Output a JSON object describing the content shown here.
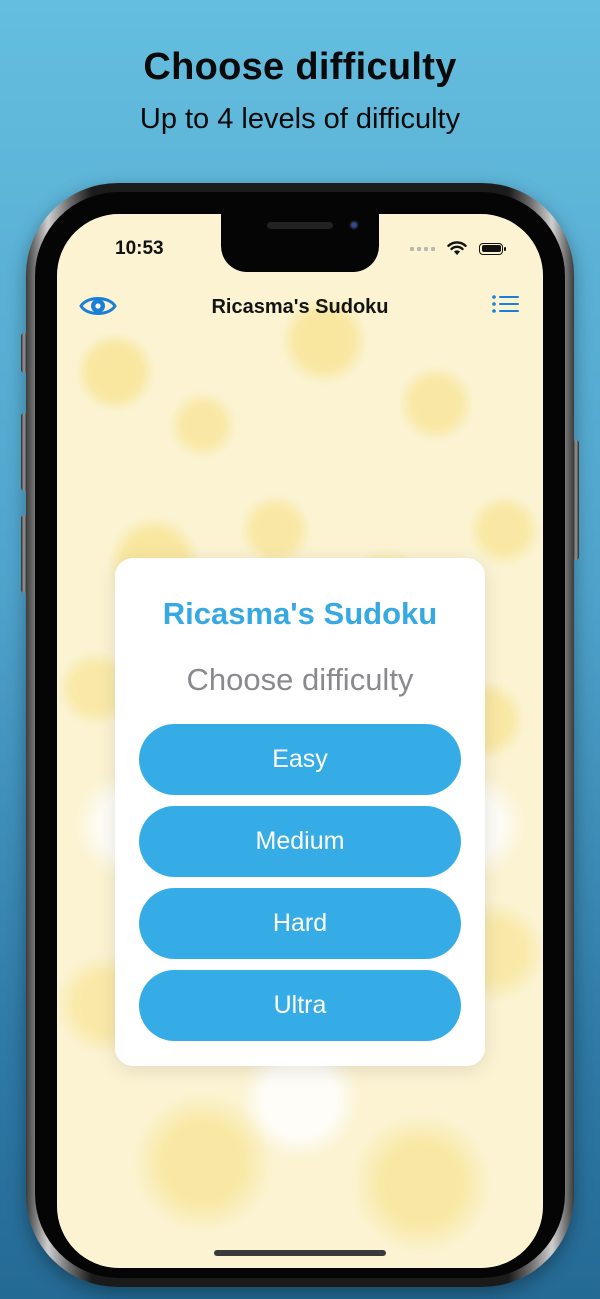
{
  "promo": {
    "title": "Choose difficulty",
    "subtitle": "Up to 4 levels of difficulty"
  },
  "status_bar": {
    "time": "10:53",
    "icons": [
      "cellular-signal-icon",
      "wifi-icon",
      "battery-icon"
    ]
  },
  "nav_bar": {
    "title": "Ricasma's Sudoku",
    "left_icon": "eye-icon",
    "right_icon": "list-icon",
    "accent_color": "#1a7fd8"
  },
  "dialog": {
    "title": "Ricasma's Sudoku",
    "subtitle": "Choose difficulty",
    "title_color": "#36a9e3",
    "button_color": "#36ace6",
    "buttons": [
      {
        "label": "Easy"
      },
      {
        "label": "Medium"
      },
      {
        "label": "Hard"
      },
      {
        "label": "Ultra"
      }
    ]
  }
}
